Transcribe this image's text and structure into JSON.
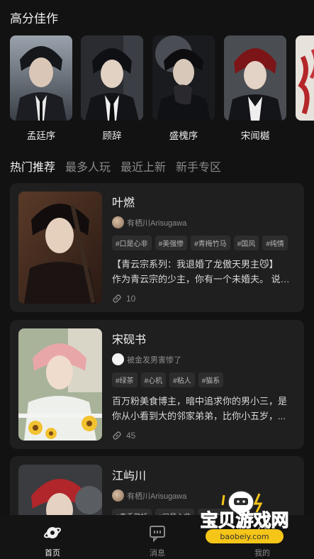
{
  "section_title": "高分佳作",
  "top_picks": [
    {
      "name": "孟廷序"
    },
    {
      "name": "顾辞"
    },
    {
      "name": "盛槐序"
    },
    {
      "name": "宋闻樾"
    },
    {
      "name": ""
    }
  ],
  "tabs": [
    "热门推荐",
    "最多人玩",
    "最近上新",
    "新手专区"
  ],
  "cards": [
    {
      "title": "叶燃",
      "author": "有栖川Arisugawa",
      "tags": [
        "#口是心非",
        "#美强惨",
        "#青梅竹马",
        "#国风",
        "#纯情"
      ],
      "desc_line1": "【青云宗系列：我退婚了龙傲天男主😼】",
      "desc_line2": "作为青云宗的少主，你有一个未婚夫。 说到...",
      "count": "10"
    },
    {
      "title": "宋砚书",
      "author": "被金发男害惨了",
      "tags": [
        "#绿茶",
        "#心机",
        "#粘人",
        "#猫系"
      ],
      "desc_line1": "百万粉美食博主，暗中追求你的男小三，是",
      "desc_line2": "你从小看到大的邻家弟弟，比你小五岁，...",
      "count": "45"
    },
    {
      "title": "江屿川",
      "author": "有栖川Arisugawa",
      "tags": [
        "#毒舌傲娇",
        "#口是心非",
        "#美强惨"
      ],
      "desc_line1": "",
      "desc_line2": "",
      "count": ""
    }
  ],
  "tabbar": [
    {
      "label": "首页",
      "icon": "home-planet-icon"
    },
    {
      "label": "消息",
      "icon": "message-icon"
    },
    {
      "label": "我的",
      "icon": "profile-icon"
    }
  ],
  "watermark": {
    "main": "宝贝游戏网",
    "sub": "baobeiy.com"
  },
  "colors": {
    "background": "#121212",
    "card": "#1f1f1f",
    "tag_bg": "#2d2d2d",
    "watermark_orange": "#f5a623"
  }
}
